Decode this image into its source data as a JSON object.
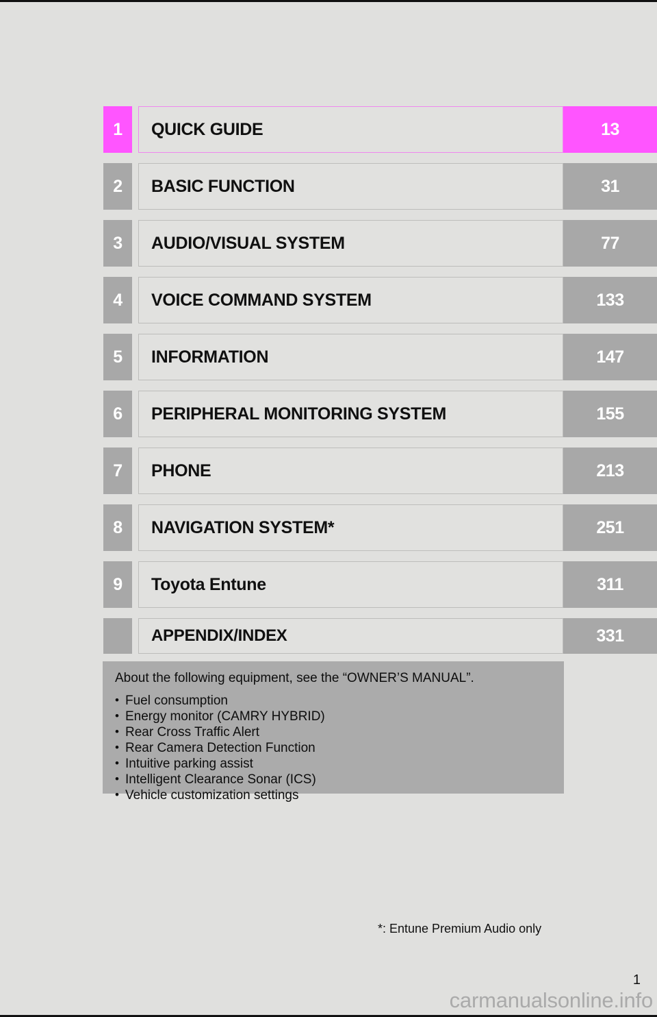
{
  "page": {
    "folio": "1",
    "watermark": "carmanualsonline.info",
    "footnote": "*: Entune Premium Audio only",
    "background_color": "#e0e0de",
    "highlight_color": "#ff55ff",
    "chip_color": "#a8a8a8"
  },
  "toc": {
    "rows": [
      {
        "number": "1",
        "title": "QUICK GUIDE",
        "page": "13",
        "highlighted": true
      },
      {
        "number": "2",
        "title": "BASIC FUNCTION",
        "page": "31",
        "highlighted": false
      },
      {
        "number": "3",
        "title": "AUDIO/VISUAL SYSTEM",
        "page": "77",
        "highlighted": false
      },
      {
        "number": "4",
        "title": "VOICE COMMAND SYSTEM",
        "page": "133",
        "highlighted": false
      },
      {
        "number": "5",
        "title": "INFORMATION",
        "page": "147",
        "highlighted": false
      },
      {
        "number": "6",
        "title": "PERIPHERAL MONITORING SYSTEM",
        "page": "155",
        "highlighted": false
      },
      {
        "number": "7",
        "title": "PHONE",
        "page": "213",
        "highlighted": false
      },
      {
        "number": "8",
        "title": "NAVIGATION SYSTEM*",
        "page": "251",
        "highlighted": false
      },
      {
        "number": "9",
        "title": "Toyota Entune",
        "page": "311",
        "highlighted": false
      },
      {
        "number": "",
        "title": "APPENDIX/INDEX",
        "page": "331",
        "highlighted": false
      }
    ]
  },
  "notebox": {
    "heading": "About the following equipment, see the “OWNER’S MANUAL”.",
    "bullet_glyph": "•",
    "items": [
      "Fuel consumption",
      "Energy monitor (CAMRY HYBRID)",
      "Rear Cross Traffic Alert",
      "Rear Camera Detection Function",
      "Intuitive parking assist",
      "Intelligent Clearance Sonar (ICS)",
      "Vehicle customization settings"
    ]
  }
}
